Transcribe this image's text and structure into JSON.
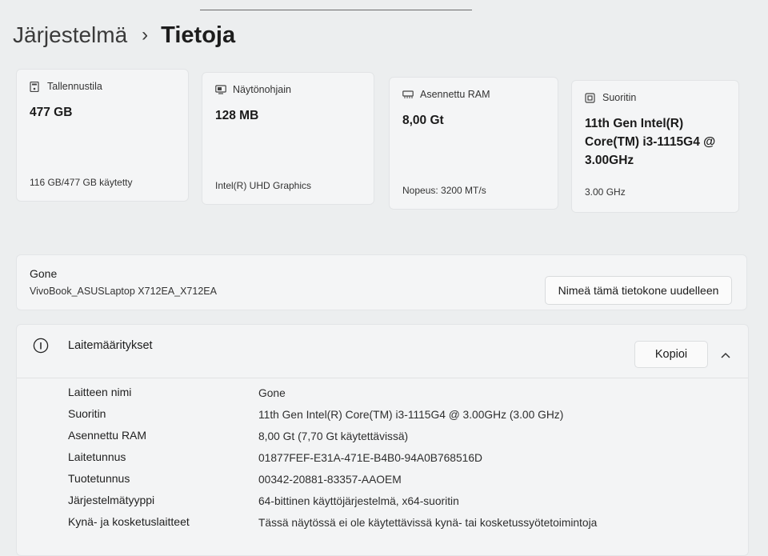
{
  "breadcrumb": {
    "parent": "Järjestelmä",
    "separator": "›",
    "current": "Tietoja"
  },
  "cards": [
    {
      "icon": "storage-icon",
      "title": "Tallennustila",
      "value": "477 GB",
      "footer": "116 GB/477 GB käytetty"
    },
    {
      "icon": "display-adapter-icon",
      "title": "Näytönohjain",
      "value": "128 MB",
      "footer": "Intel(R) UHD Graphics"
    },
    {
      "icon": "ram-icon",
      "title": "Asennettu RAM",
      "value": "8,00 Gt",
      "footer": "Nopeus: 3200 MT/s"
    },
    {
      "icon": "processor-icon",
      "title": "Suoritin",
      "value_lines": [
        "11th Gen Intel(R)",
        "Core(TM) i3-1115G4 @",
        "3.00GHz"
      ],
      "footer": "3.00 GHz"
    }
  ],
  "device": {
    "name": "Gone",
    "model": "VivoBook_ASUSLaptop X712EA_X712EA",
    "rename_label": "Nimeä tämä tietokone uudelleen"
  },
  "specs": {
    "title": "Laitemääritykset",
    "copy_label": "Kopioi",
    "rows": [
      {
        "key": "Laitteen nimi",
        "value": "Gone"
      },
      {
        "key": "Suoritin",
        "value": "11th Gen Intel(R) Core(TM) i3-1115G4 @ 3.00GHz (3.00 GHz)"
      },
      {
        "key": "Asennettu RAM",
        "value": "8,00 Gt (7,70 Gt käytettävissä)"
      },
      {
        "key": "Laitetunnus",
        "value": "01877FEF-E31A-471E-B4B0-94A0B768516D"
      },
      {
        "key": "Tuotetunnus",
        "value": "00342-20881-83357-AAOEM"
      },
      {
        "key": "Järjestelmätyyppi",
        "value": "64-bittinen käyttöjärjestelmä, x64-suoritin"
      },
      {
        "key": "Kynä- ja kosketuslaitteet",
        "value": "Tässä näytössä ei ole käytettävissä kynä- tai kosketussyötetoimintoja"
      }
    ]
  }
}
